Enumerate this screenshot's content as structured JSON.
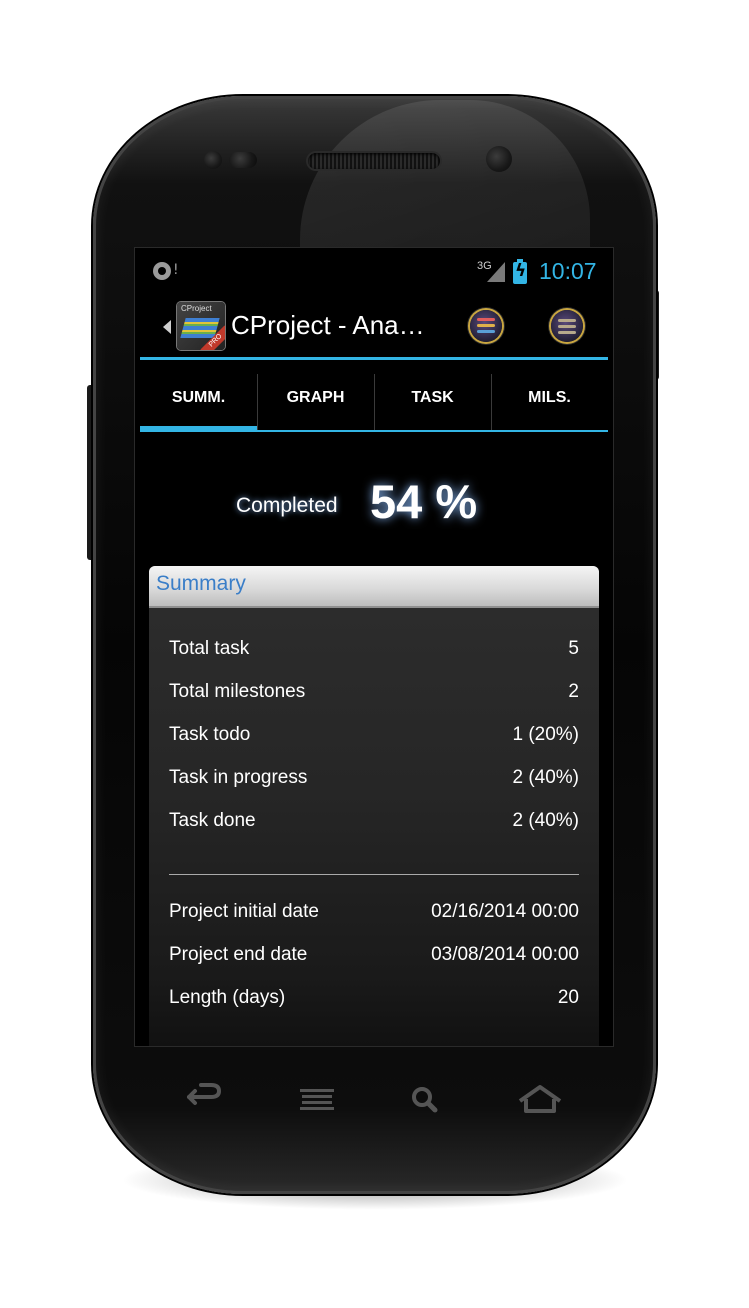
{
  "status_bar": {
    "network": "3G",
    "time": "10:07"
  },
  "action_bar": {
    "title": "CProject - Ana…",
    "logo_text": "CProject",
    "logo_badge": "PRO"
  },
  "tabs": [
    {
      "label": "SUMM.",
      "active": true
    },
    {
      "label": "GRAPH",
      "active": false
    },
    {
      "label": "TASK",
      "active": false
    },
    {
      "label": "MILS.",
      "active": false
    }
  ],
  "progress": {
    "label": "Completed",
    "value": "54 %"
  },
  "summary": {
    "title": "Summary",
    "stats": [
      {
        "label": "Total task",
        "value": "5"
      },
      {
        "label": "Total milestones",
        "value": "2"
      },
      {
        "label": "Task todo",
        "value": "1 (20%)"
      },
      {
        "label": "Task in progress",
        "value": "2 (40%)"
      },
      {
        "label": "Task done",
        "value": "2 (40%)"
      }
    ],
    "dates": [
      {
        "label": "Project initial date",
        "value": "02/16/2014 00:00"
      },
      {
        "label": "Project end date",
        "value": "03/08/2014 00:00"
      },
      {
        "label": "Length (days)",
        "value": "20"
      }
    ]
  },
  "colors": {
    "accent": "#33b5e5",
    "summary_title": "#3a7ec8"
  },
  "icons": {
    "status_left": "sync-alert-icon",
    "signal": "signal-icon",
    "battery": "battery-charging-icon",
    "nav_back": "back-icon",
    "nav_menu": "menu-icon",
    "nav_search": "search-icon",
    "nav_home": "home-icon"
  }
}
